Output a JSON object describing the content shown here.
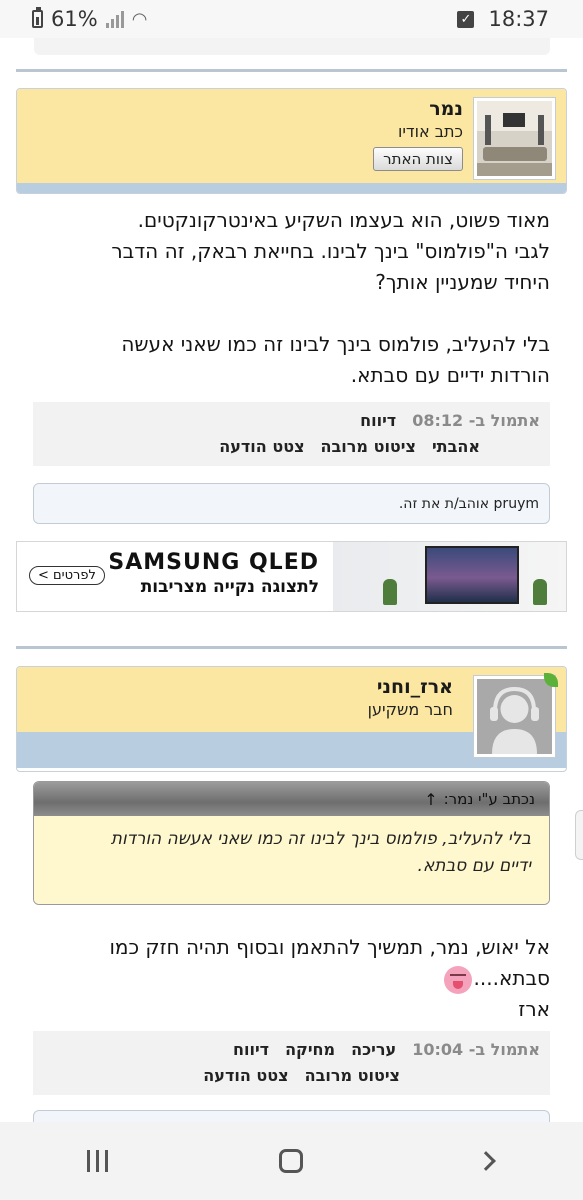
{
  "status_bar": {
    "battery": "61%",
    "time": "18:37"
  },
  "post1": {
    "author": {
      "name": "נמר",
      "title": "כתב אודיו",
      "badge": "צוות האתר"
    },
    "lines": [
      "מאוד פשוט, הוא בעצמו השקיע באינטרקונקטים.",
      "לגבי ה\"פולמוס\" בינך לבינו. בחייאת רבאק, זה הדבר",
      "היחיד שמעניין אותך?",
      "",
      "בלי להעליב, פולמוס בינך לבינו זה כמו שאני אעשה",
      "הורדות ידיים עם סבתא."
    ],
    "meta": {
      "time_label": "אתמול ב- 08:12",
      "report": "דיווח"
    },
    "actions": {
      "like": "אהבתי",
      "multi_quote": "ציטוט מרובה",
      "quote": "צטט הודעה"
    },
    "likes_text": "pruym אוהב/ת את זה."
  },
  "ad": {
    "brand": "SAMSUNG QLED",
    "tagline": "לתצוגה נקייה מצריבות",
    "button": "לפרטים"
  },
  "post2": {
    "author": {
      "name": "ארז_וחני",
      "title": "חבר משקיען"
    },
    "quote": {
      "header": "נכתב ע\"י נמר:",
      "lines": [
        "בלי להעליב, פולמוס בינך לבינו זה כמו שאני אעשה הורדות",
        "ידיים עם סבתא."
      ]
    },
    "lines": [
      "אל יאוש, נמר, תמשיך להתאמן ובסוף תהיה חזק כמו",
      "סבתא....",
      "ארז"
    ],
    "meta": {
      "time_label": "אתמול ב- 10:04",
      "edit": "עריכה",
      "delete": "מחיקה",
      "report": "דיווח"
    },
    "actions": {
      "multi_quote": "ציטוט מרובה",
      "quote": "צטט הודעה"
    }
  }
}
